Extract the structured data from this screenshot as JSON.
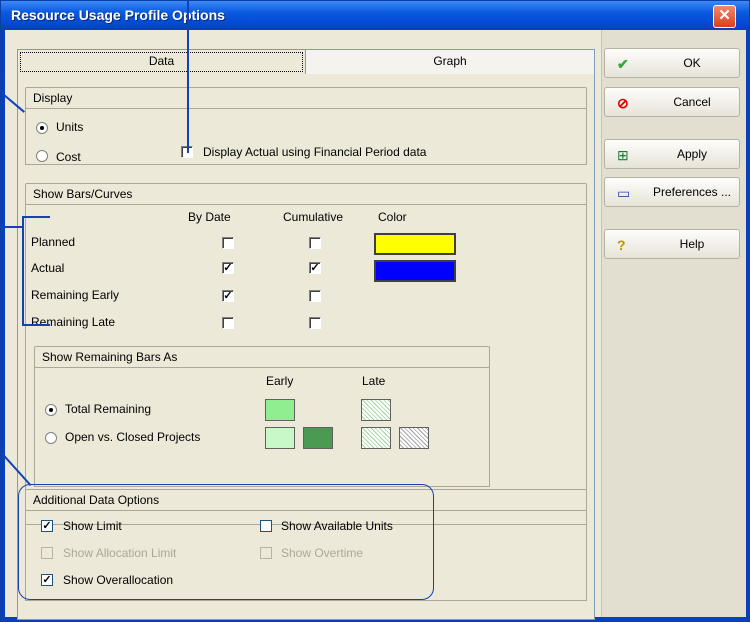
{
  "window": {
    "title": "Resource Usage Profile Options",
    "close_symbol": "✕"
  },
  "tabs": [
    {
      "label": "Data",
      "selected": true
    },
    {
      "label": "Graph",
      "selected": false
    }
  ],
  "display": {
    "header": "Display",
    "units_label": "Units",
    "cost_label": "Cost",
    "selected": "Units",
    "financial_label": "Display Actual using Financial Period data",
    "financial_checked": false
  },
  "bars": {
    "header": "Show Bars/Curves",
    "col_by_date": "By Date",
    "col_cumulative": "Cumulative",
    "col_color": "Color",
    "rows": [
      {
        "label": "Planned",
        "by_date": false,
        "cumulative": false,
        "color": "#ffff00"
      },
      {
        "label": "Actual",
        "by_date": true,
        "cumulative": true,
        "color": "#0000ff"
      },
      {
        "label": "Remaining Early",
        "by_date": true,
        "cumulative": false
      },
      {
        "label": "Remaining Late",
        "by_date": false,
        "cumulative": false
      }
    ]
  },
  "remaining": {
    "header": "Show Remaining Bars As",
    "col_early": "Early",
    "col_late": "Late",
    "total_label": "Total Remaining",
    "open_label": "Open vs. Closed Projects",
    "selected": "Total Remaining",
    "colors": {
      "early_light": "#90ee90",
      "early_pale": "#c8f7c8",
      "early_dark": "#4a9a52"
    }
  },
  "additional": {
    "header": "Additional Data Options",
    "show_limit": "Show Limit",
    "show_available": "Show Available Units",
    "show_allocation": "Show Allocation Limit",
    "show_overtime": "Show Overtime",
    "show_overallocation": "Show Overallocation",
    "checked": {
      "show_limit": true,
      "show_available": false,
      "show_allocation": false,
      "show_overtime": false,
      "show_overallocation": true
    }
  },
  "buttons": [
    {
      "label": "OK",
      "icon": "checkmark-icon"
    },
    {
      "label": "Cancel",
      "icon": "cancel-icon"
    },
    {
      "label": "Apply",
      "icon": "apply-icon"
    },
    {
      "label": "Preferences ...",
      "icon": "preferences-icon"
    },
    {
      "label": "Help",
      "icon": "help-icon"
    }
  ],
  "colors": {
    "callout": "#1441b4",
    "titlebar": "#0a5ae0"
  }
}
